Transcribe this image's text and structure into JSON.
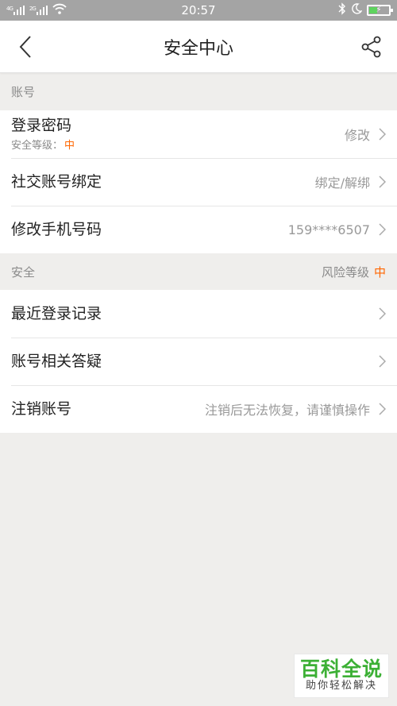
{
  "status_bar": {
    "net1": "4G",
    "net2": "2G",
    "time": "20:57",
    "battery_text": "⚡"
  },
  "header": {
    "title": "安全中心"
  },
  "sections": {
    "account": {
      "label": "账号",
      "rows": [
        {
          "title": "登录密码",
          "sub_label": "安全等级：",
          "sub_value": "中",
          "value": "修改"
        },
        {
          "title": "社交账号绑定",
          "value": "绑定/解绑"
        },
        {
          "title": "修改手机号码",
          "value": "159****6507"
        }
      ]
    },
    "security": {
      "label": "安全",
      "risk_label": "风险等级",
      "risk_value": "中",
      "rows": [
        {
          "title": "最近登录记录",
          "value": ""
        },
        {
          "title": "账号相关答疑",
          "value": ""
        },
        {
          "title": "注销账号",
          "value": "注销后无法恢复，请谨慎操作"
        }
      ]
    }
  },
  "watermark": {
    "title": "百科全说",
    "subtitle": "助你轻松解决"
  },
  "colors": {
    "accent": "#ff6600",
    "background": "#efeeec",
    "status_bar": "#a4a4a4",
    "watermark": "#3cb035"
  },
  "icons": {
    "back": "chevron-left-icon",
    "share": "share-icon",
    "row_arrow": "chevron-right-icon"
  }
}
